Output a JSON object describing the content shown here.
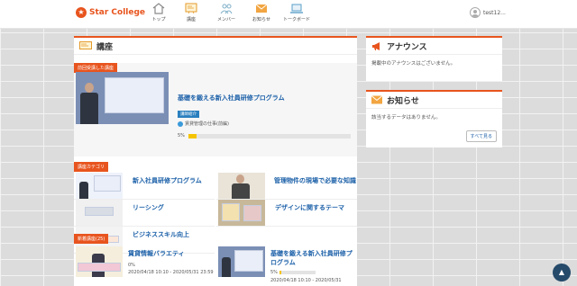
{
  "app": {
    "logo_text": "Star College"
  },
  "nav": {
    "items": [
      {
        "label": "トップ"
      },
      {
        "label": "講座"
      },
      {
        "label": "メンバー"
      },
      {
        "label": "お知らせ"
      },
      {
        "label": "トークボード"
      }
    ]
  },
  "user": {
    "name": "test12..."
  },
  "courses_panel": {
    "title": "講座",
    "recent_tag": "前回受講した講座",
    "featured": {
      "title": "基礎を鍛える新入社員研修プログラム",
      "subtag": "講師紹介",
      "item_label": "賃貸管理の仕事(前編)",
      "progress_text": "5%",
      "progress": 0.05
    },
    "categories_tag": "講座カテゴリ",
    "categories": [
      {
        "label": "新入社員研修プログラム"
      },
      {
        "label": "管理物件の現場で必要な知識"
      },
      {
        "label": "リーシング"
      },
      {
        "label": "デザインに関するテーマ"
      },
      {
        "label": "ビジネススキル向上"
      }
    ],
    "new_tag": "新着講座(25)",
    "new_courses": [
      {
        "title": "賃貸情報バラエティ",
        "progress_text": "0%",
        "progress": 0,
        "period": "2020/04/18 10:10 - 2020/05/31 23:59"
      },
      {
        "title": "基礎を鍛える新入社員研修プログラム",
        "progress_text": "5%",
        "progress": 0.05,
        "period": "2020/04/18 10:10 - 2020/05/31"
      }
    ]
  },
  "announce_panel": {
    "title": "アナウンス",
    "body": "掲載中のアナウンスはございません。"
  },
  "news_panel": {
    "title": "お知らせ",
    "body": "該当するデータはありません。",
    "more_label": "すべて見る"
  },
  "scroll_top": {
    "icon": "chevron-up-icon",
    "glyph": "▲"
  },
  "colors": {
    "accent": "#e8541e",
    "link": "#1a5fa8",
    "progress": "#f5c400",
    "scroll_top_bg": "#254a6a"
  }
}
